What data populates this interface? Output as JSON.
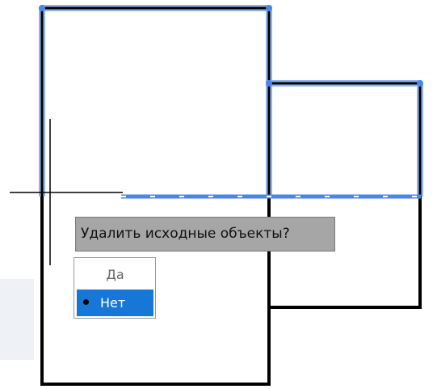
{
  "colors": {
    "selected_outline": "#4a86e8",
    "drawing_line": "#000000",
    "prompt_bg": "#a6a6a6",
    "menu_highlight": "#1677d6"
  },
  "prompt": {
    "text": "Удалить исходные объекты?"
  },
  "options": [
    {
      "label": "Да",
      "selected": false
    },
    {
      "label": "Нет",
      "selected": true,
      "marker_icon": "bullet-icon"
    }
  ]
}
